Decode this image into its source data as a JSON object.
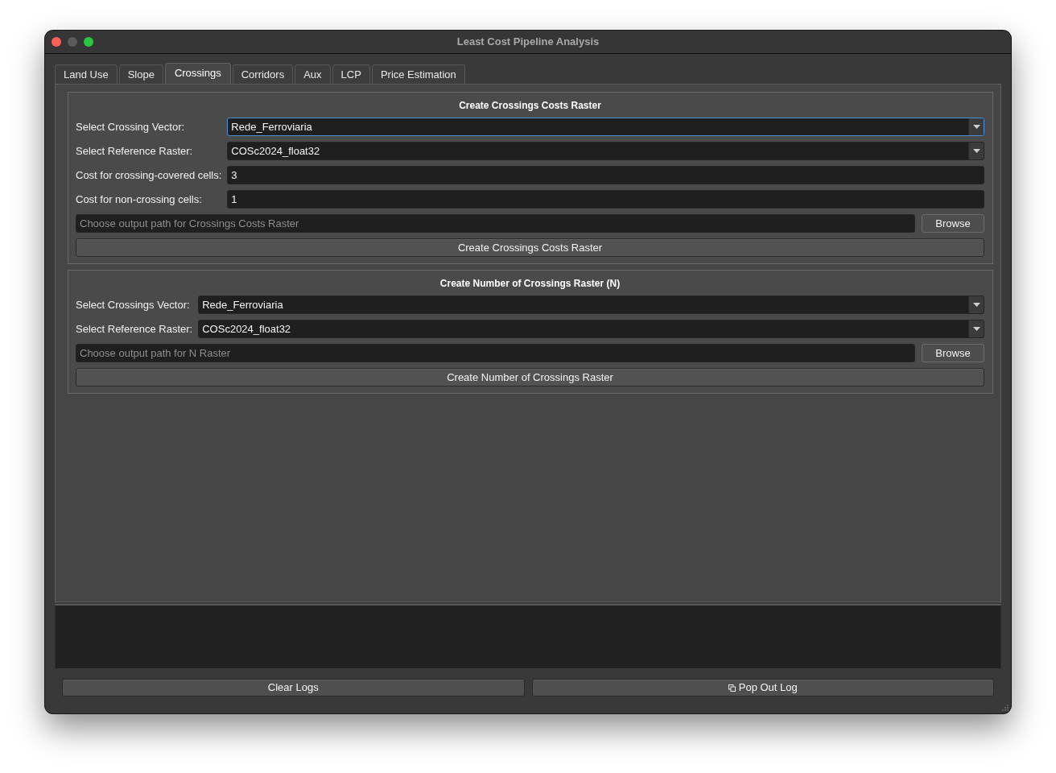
{
  "window": {
    "title": "Least Cost Pipeline Analysis",
    "controls": [
      {
        "kind": "close",
        "disabled": false
      },
      {
        "kind": "minimize",
        "disabled": true
      },
      {
        "kind": "zoom",
        "disabled": false
      }
    ]
  },
  "tabs": [
    {
      "label": "Land Use",
      "selected": false
    },
    {
      "label": "Slope",
      "selected": false
    },
    {
      "label": "Crossings",
      "selected": true
    },
    {
      "label": "Corridors",
      "selected": false
    },
    {
      "label": "Aux",
      "selected": false
    },
    {
      "label": "LCP",
      "selected": false
    },
    {
      "label": "Price Estimation",
      "selected": false
    }
  ],
  "groups": [
    {
      "title": "Create Crossings Costs Raster",
      "fields": [
        {
          "kind": "combo",
          "label": "Select Crossing Vector:",
          "value": "Rede_Ferroviaria",
          "focused": true
        },
        {
          "kind": "combo",
          "label": "Select Reference Raster:",
          "value": "COSc2024_float32",
          "focused": false
        },
        {
          "kind": "text",
          "label": "Cost for crossing-covered cells:",
          "value": "3",
          "focused": false
        },
        {
          "kind": "text",
          "label": "Cost for non-crossing cells:",
          "value": "1",
          "focused": false
        }
      ],
      "output": {
        "placeholder": "Choose output path for Crossings Costs Raster",
        "button": "Browse"
      },
      "action": "Create Crossings Costs Raster"
    },
    {
      "title": "Create Number of Crossings Raster (N)",
      "fields": [
        {
          "kind": "combo",
          "label": "Select Crossings Vector:",
          "value": "Rede_Ferroviaria",
          "focused": false
        },
        {
          "kind": "combo",
          "label": "Select Reference Raster:",
          "value": "COSc2024_float32",
          "focused": false
        }
      ],
      "output": {
        "placeholder": "Choose output path for N Raster",
        "button": "Browse"
      },
      "action": "Create Number of Crossings Raster"
    }
  ],
  "buttons": [
    {
      "kind": "plain",
      "label": "Clear Logs"
    },
    {
      "kind": "popout",
      "label": "Pop Out Log"
    }
  ]
}
